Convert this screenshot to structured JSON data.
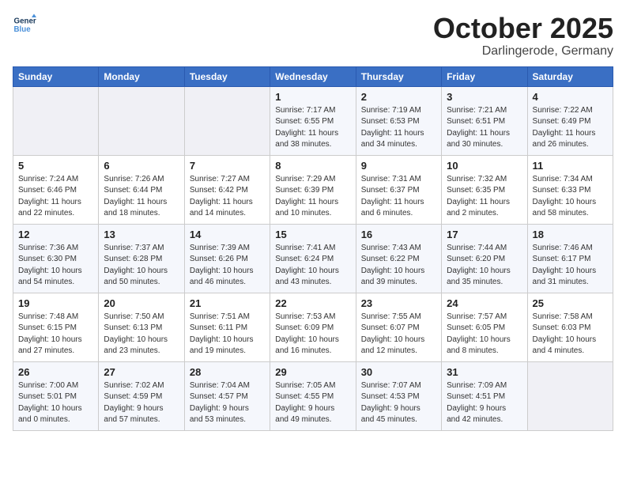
{
  "header": {
    "logo_line1": "General",
    "logo_line2": "Blue",
    "month": "October 2025",
    "location": "Darlingerode, Germany"
  },
  "weekdays": [
    "Sunday",
    "Monday",
    "Tuesday",
    "Wednesday",
    "Thursday",
    "Friday",
    "Saturday"
  ],
  "weeks": [
    [
      {
        "day": "",
        "info": ""
      },
      {
        "day": "",
        "info": ""
      },
      {
        "day": "",
        "info": ""
      },
      {
        "day": "1",
        "info": "Sunrise: 7:17 AM\nSunset: 6:55 PM\nDaylight: 11 hours\nand 38 minutes."
      },
      {
        "day": "2",
        "info": "Sunrise: 7:19 AM\nSunset: 6:53 PM\nDaylight: 11 hours\nand 34 minutes."
      },
      {
        "day": "3",
        "info": "Sunrise: 7:21 AM\nSunset: 6:51 PM\nDaylight: 11 hours\nand 30 minutes."
      },
      {
        "day": "4",
        "info": "Sunrise: 7:22 AM\nSunset: 6:49 PM\nDaylight: 11 hours\nand 26 minutes."
      }
    ],
    [
      {
        "day": "5",
        "info": "Sunrise: 7:24 AM\nSunset: 6:46 PM\nDaylight: 11 hours\nand 22 minutes."
      },
      {
        "day": "6",
        "info": "Sunrise: 7:26 AM\nSunset: 6:44 PM\nDaylight: 11 hours\nand 18 minutes."
      },
      {
        "day": "7",
        "info": "Sunrise: 7:27 AM\nSunset: 6:42 PM\nDaylight: 11 hours\nand 14 minutes."
      },
      {
        "day": "8",
        "info": "Sunrise: 7:29 AM\nSunset: 6:39 PM\nDaylight: 11 hours\nand 10 minutes."
      },
      {
        "day": "9",
        "info": "Sunrise: 7:31 AM\nSunset: 6:37 PM\nDaylight: 11 hours\nand 6 minutes."
      },
      {
        "day": "10",
        "info": "Sunrise: 7:32 AM\nSunset: 6:35 PM\nDaylight: 11 hours\nand 2 minutes."
      },
      {
        "day": "11",
        "info": "Sunrise: 7:34 AM\nSunset: 6:33 PM\nDaylight: 10 hours\nand 58 minutes."
      }
    ],
    [
      {
        "day": "12",
        "info": "Sunrise: 7:36 AM\nSunset: 6:30 PM\nDaylight: 10 hours\nand 54 minutes."
      },
      {
        "day": "13",
        "info": "Sunrise: 7:37 AM\nSunset: 6:28 PM\nDaylight: 10 hours\nand 50 minutes."
      },
      {
        "day": "14",
        "info": "Sunrise: 7:39 AM\nSunset: 6:26 PM\nDaylight: 10 hours\nand 46 minutes."
      },
      {
        "day": "15",
        "info": "Sunrise: 7:41 AM\nSunset: 6:24 PM\nDaylight: 10 hours\nand 43 minutes."
      },
      {
        "day": "16",
        "info": "Sunrise: 7:43 AM\nSunset: 6:22 PM\nDaylight: 10 hours\nand 39 minutes."
      },
      {
        "day": "17",
        "info": "Sunrise: 7:44 AM\nSunset: 6:20 PM\nDaylight: 10 hours\nand 35 minutes."
      },
      {
        "day": "18",
        "info": "Sunrise: 7:46 AM\nSunset: 6:17 PM\nDaylight: 10 hours\nand 31 minutes."
      }
    ],
    [
      {
        "day": "19",
        "info": "Sunrise: 7:48 AM\nSunset: 6:15 PM\nDaylight: 10 hours\nand 27 minutes."
      },
      {
        "day": "20",
        "info": "Sunrise: 7:50 AM\nSunset: 6:13 PM\nDaylight: 10 hours\nand 23 minutes."
      },
      {
        "day": "21",
        "info": "Sunrise: 7:51 AM\nSunset: 6:11 PM\nDaylight: 10 hours\nand 19 minutes."
      },
      {
        "day": "22",
        "info": "Sunrise: 7:53 AM\nSunset: 6:09 PM\nDaylight: 10 hours\nand 16 minutes."
      },
      {
        "day": "23",
        "info": "Sunrise: 7:55 AM\nSunset: 6:07 PM\nDaylight: 10 hours\nand 12 minutes."
      },
      {
        "day": "24",
        "info": "Sunrise: 7:57 AM\nSunset: 6:05 PM\nDaylight: 10 hours\nand 8 minutes."
      },
      {
        "day": "25",
        "info": "Sunrise: 7:58 AM\nSunset: 6:03 PM\nDaylight: 10 hours\nand 4 minutes."
      }
    ],
    [
      {
        "day": "26",
        "info": "Sunrise: 7:00 AM\nSunset: 5:01 PM\nDaylight: 10 hours\nand 0 minutes."
      },
      {
        "day": "27",
        "info": "Sunrise: 7:02 AM\nSunset: 4:59 PM\nDaylight: 9 hours\nand 57 minutes."
      },
      {
        "day": "28",
        "info": "Sunrise: 7:04 AM\nSunset: 4:57 PM\nDaylight: 9 hours\nand 53 minutes."
      },
      {
        "day": "29",
        "info": "Sunrise: 7:05 AM\nSunset: 4:55 PM\nDaylight: 9 hours\nand 49 minutes."
      },
      {
        "day": "30",
        "info": "Sunrise: 7:07 AM\nSunset: 4:53 PM\nDaylight: 9 hours\nand 45 minutes."
      },
      {
        "day": "31",
        "info": "Sunrise: 7:09 AM\nSunset: 4:51 PM\nDaylight: 9 hours\nand 42 minutes."
      },
      {
        "day": "",
        "info": ""
      }
    ]
  ]
}
